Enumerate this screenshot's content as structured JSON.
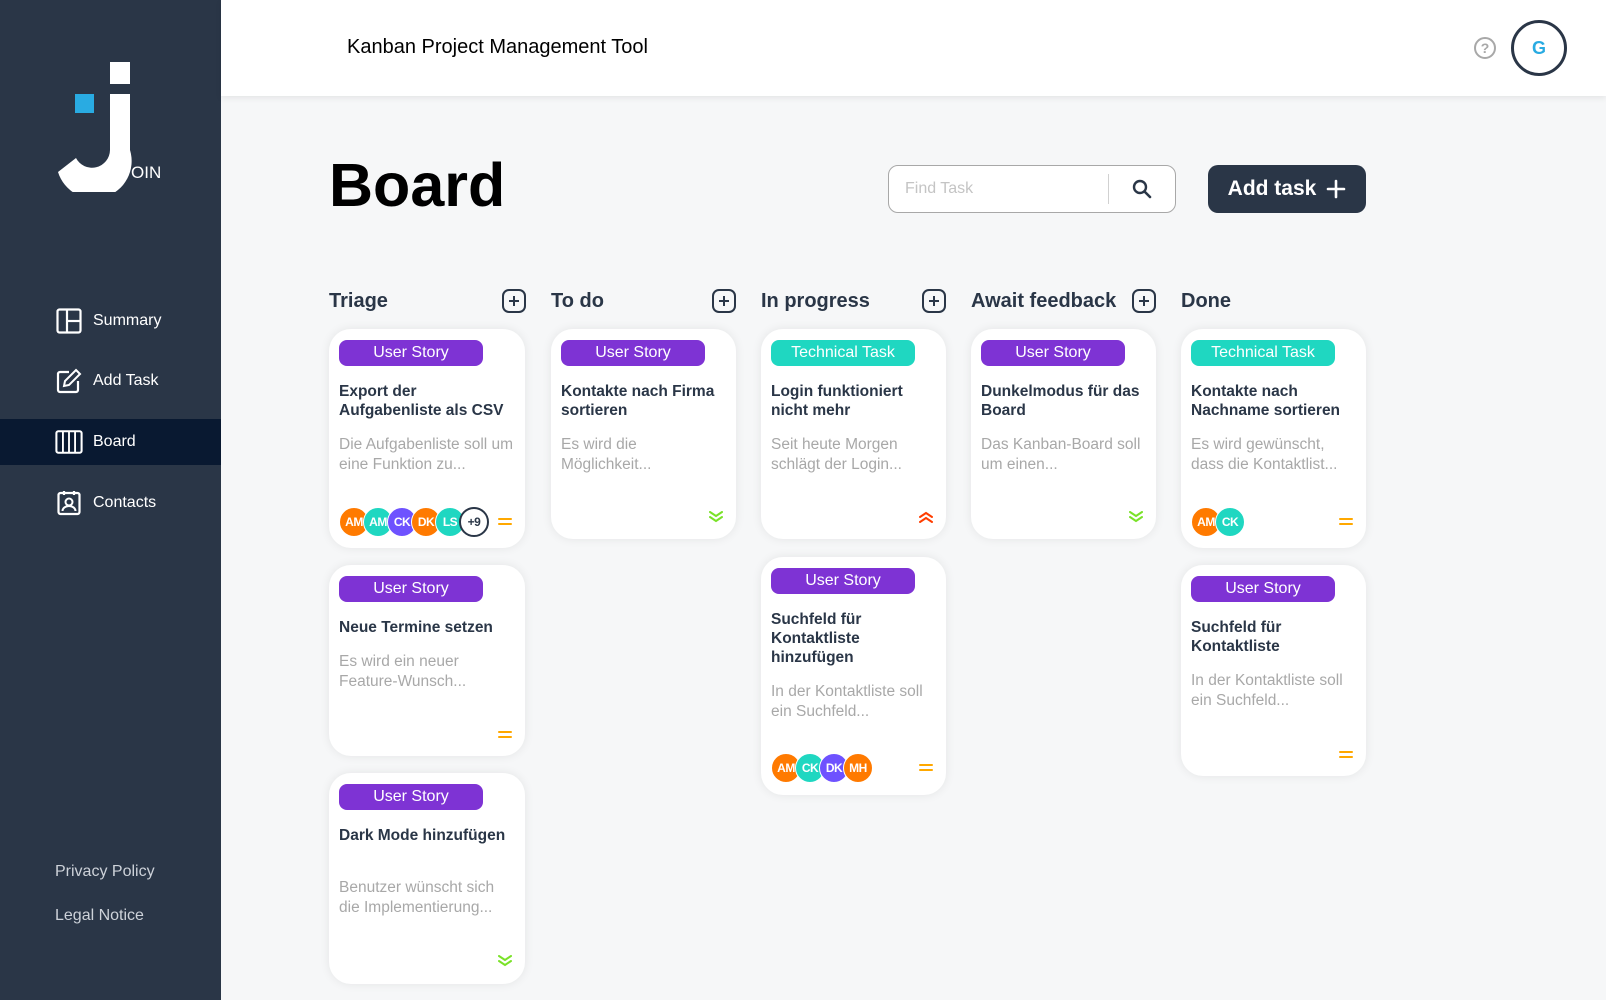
{
  "app": {
    "logo_suffix": "OIN",
    "header_title": "Kanban Project Management Tool",
    "user_initial": "G",
    "help_symbol": "?"
  },
  "nav": [
    {
      "label": "Summary",
      "icon": "summary-icon",
      "active": false
    },
    {
      "label": "Add Task",
      "icon": "edit-icon",
      "active": false
    },
    {
      "label": "Board",
      "icon": "board-icon",
      "active": true
    },
    {
      "label": "Contacts",
      "icon": "contacts-icon",
      "active": false
    }
  ],
  "footer": {
    "privacy": "Privacy Policy",
    "legal": "Legal Notice"
  },
  "board": {
    "title": "Board",
    "search_placeholder": "Find Task",
    "add_task_label": "Add task"
  },
  "columns": [
    "Triage",
    "To do",
    "In progress",
    "Await feedback",
    "Done"
  ],
  "cards": {
    "triage_1": {
      "tag": "User Story",
      "title": "Export der Aufgabenliste als CSV",
      "desc": "Die Aufgabenliste soll um eine Funktion zu...",
      "avatars": [
        "AM",
        "AM",
        "CK",
        "DK",
        "LS"
      ],
      "more": "+9",
      "priority": "medium"
    },
    "triage_2": {
      "tag": "User Story",
      "title": "Neue Termine setzen",
      "desc": "Es wird ein neuer Feature-Wunsch...",
      "priority": "medium"
    },
    "triage_3": {
      "tag": "User Story",
      "title": "Dark Mode hinzufügen",
      "desc": "Benutzer wünscht sich die Implementierung...",
      "priority": "low"
    },
    "todo_1": {
      "tag": "User Story",
      "title": "Kontakte nach Firma sortieren",
      "desc": "Es wird die Möglichkeit...",
      "priority": "low"
    },
    "progress_1": {
      "tag": "Technical Task",
      "title": "Login funktioniert nicht mehr",
      "desc": "Seit heute Morgen schlägt der Login...",
      "priority": "urgent"
    },
    "progress_2": {
      "tag": "User Story",
      "title": "Suchfeld für Kontaktliste hinzufügen",
      "desc": "In der Kontaktliste soll ein Suchfeld...",
      "avatars": [
        "AM",
        "CK",
        "DK",
        "MH"
      ],
      "priority": "medium"
    },
    "feedback_1": {
      "tag": "User Story",
      "title": "Dunkelmodus für das Board",
      "desc": "Das Kanban-Board soll um einen...",
      "priority": "low"
    },
    "done_1": {
      "tag": "Technical Task",
      "title": "Kontakte nach Nachname sortieren",
      "desc": "Es wird gewünscht, dass die Kontaktlist...",
      "avatars": [
        "AM",
        "CK"
      ],
      "priority": "medium"
    },
    "done_2": {
      "tag": "User Story",
      "title": "Suchfeld für Kontaktliste",
      "desc": "In der Kontaktliste soll ein Suchfeld...",
      "priority": "medium"
    }
  },
  "colors": {
    "sidebar": "#2a3647",
    "active_nav": "#091931",
    "user_story": "#7e33d4",
    "technical_task": "#1fd7c1",
    "orange": "#ff7a00",
    "teal": "#1fd7c1",
    "violet": "#6e52ff",
    "urgent": "#ff3d00",
    "medium": "#ffa800",
    "low": "#7ae229"
  }
}
